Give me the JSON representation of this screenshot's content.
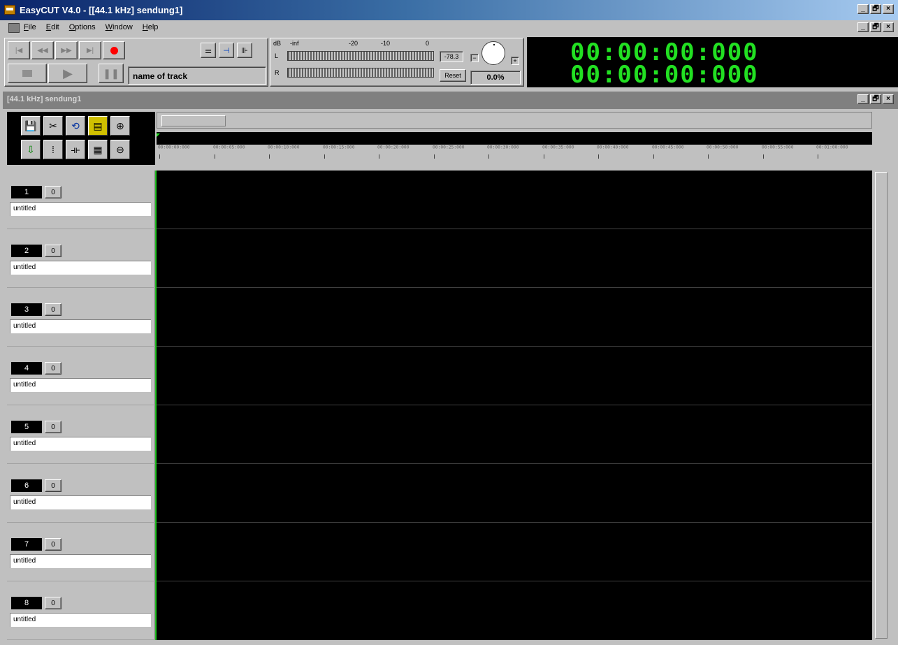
{
  "window": {
    "title": "EasyCUT V4.0 - [[44.1 kHz] sendung1]",
    "caption_buttons": [
      "_",
      "🗗",
      "×"
    ]
  },
  "menu": {
    "items": [
      "File",
      "Edit",
      "Options",
      "Window",
      "Help"
    ],
    "caption_buttons": [
      "_",
      "🗗",
      "×"
    ]
  },
  "transport": {
    "track_name": "name of track",
    "icons": [
      "skip-start-icon",
      "rewind-icon",
      "fast-forward-icon",
      "skip-end-icon",
      "record-icon",
      "stop-icon",
      "play-icon",
      "pause-icon"
    ]
  },
  "meters": {
    "db_label": "dB",
    "scale": [
      "-inf",
      "-20",
      "-10",
      "0"
    ],
    "left_label": "L",
    "right_label": "R",
    "peak_value": "-78.3",
    "reset_label": "Reset",
    "percent": "0.0%",
    "minus": "−",
    "plus": "+"
  },
  "time_display": {
    "time1": "00:00:00:000",
    "time2": "00:00:00:000",
    "color": "#22e022"
  },
  "document": {
    "title": "[44.1 kHz] sendung1",
    "caption_buttons": [
      "_",
      "🗗",
      "×"
    ]
  },
  "ruler": {
    "ticks": [
      "00:00:00:000",
      "00:00:05:000",
      "00:00:10:000",
      "00:00:15:000",
      "00:00:20:000",
      "00:00:25:000",
      "00:00:30:000",
      "00:00:35:000",
      "00:00:40:000",
      "00:00:45:000",
      "00:00:50:000",
      "00:00:55:000",
      "00:01:00:000"
    ]
  },
  "tracks": [
    {
      "number": "1",
      "volume": "0",
      "name": "untitled"
    },
    {
      "number": "2",
      "volume": "0",
      "name": "untitled"
    },
    {
      "number": "3",
      "volume": "0",
      "name": "untitled"
    },
    {
      "number": "4",
      "volume": "0",
      "name": "untitled"
    },
    {
      "number": "5",
      "volume": "0",
      "name": "untitled"
    },
    {
      "number": "6",
      "volume": "0",
      "name": "untitled"
    },
    {
      "number": "7",
      "volume": "0",
      "name": "untitled"
    },
    {
      "number": "8",
      "volume": "0",
      "name": "untitled"
    }
  ]
}
